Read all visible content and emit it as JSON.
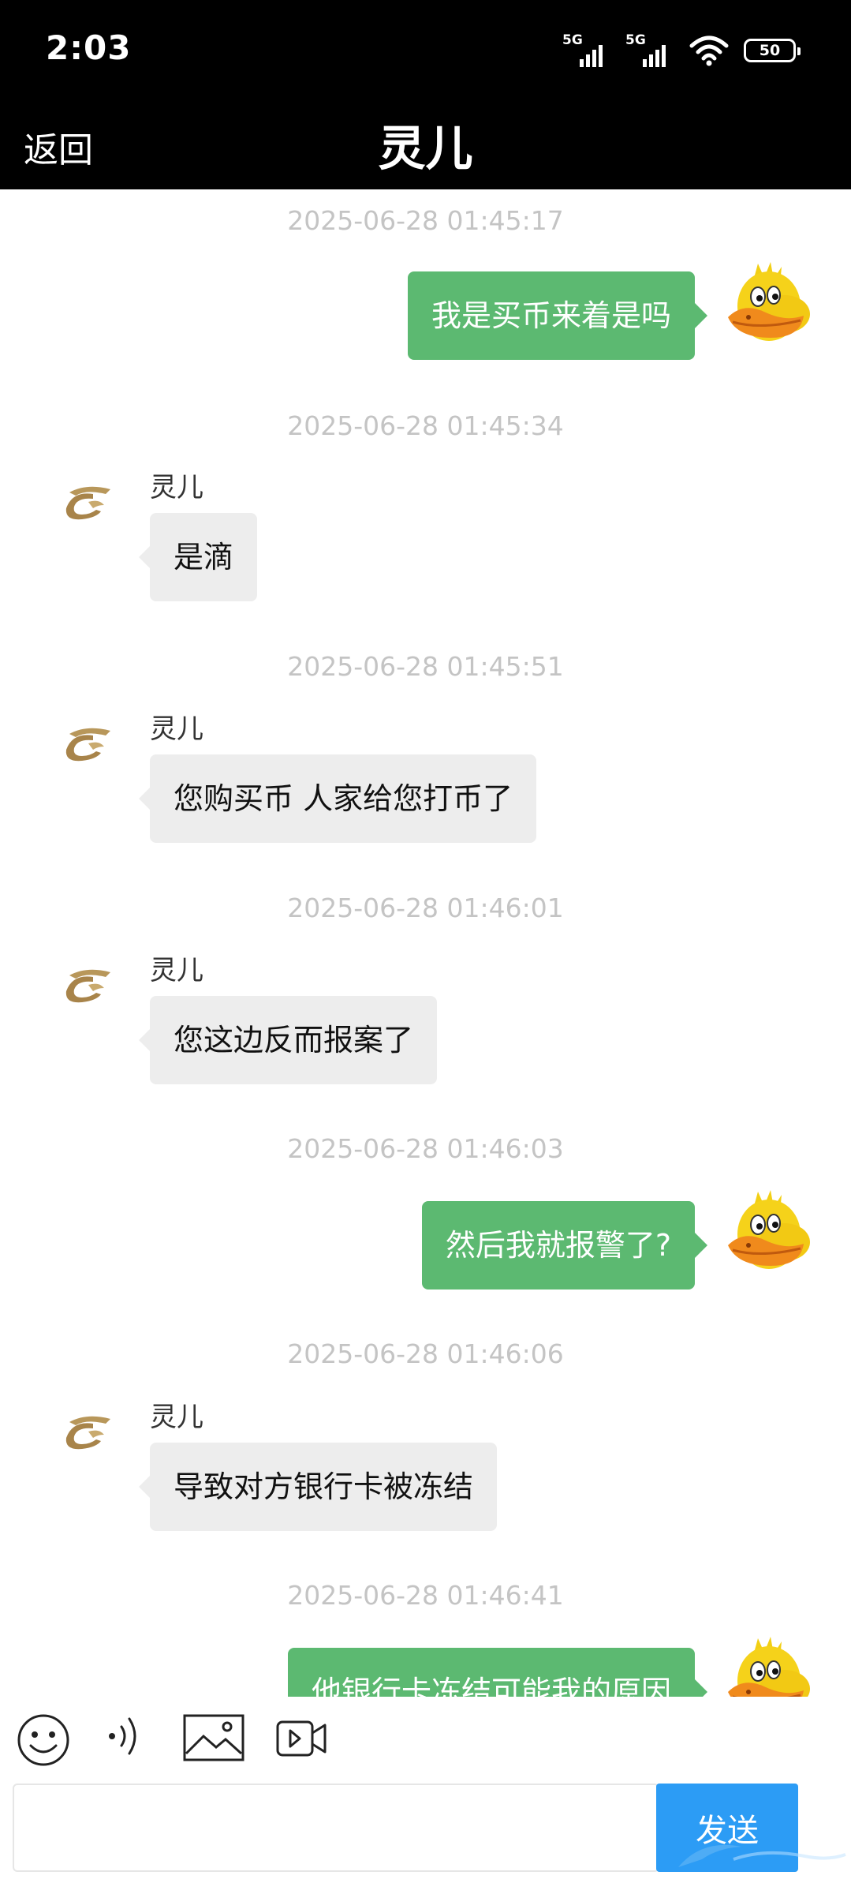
{
  "status_bar": {
    "time": "2:03",
    "signal_1_label": "5G",
    "signal_2_label": "5G",
    "battery": "50",
    "icons": [
      "signal-5g-icon",
      "signal-5g-icon",
      "wifi-icon",
      "battery-icon"
    ]
  },
  "nav": {
    "back_label": "返回",
    "title": "灵儿"
  },
  "messages": [
    {
      "timestamp": "2025-06-28 01:45:17",
      "direction": "out",
      "text": "我是买币来着是吗"
    },
    {
      "timestamp": "2025-06-28 01:45:34",
      "direction": "in",
      "sender": "灵儿",
      "text": "是滴"
    },
    {
      "timestamp": "2025-06-28 01:45:51",
      "direction": "in",
      "sender": "灵儿",
      "text": "您购买币 人家给您打币了"
    },
    {
      "timestamp": "2025-06-28 01:46:01",
      "direction": "in",
      "sender": "灵儿",
      "text": "您这边反而报案了"
    },
    {
      "timestamp": "2025-06-28 01:46:03",
      "direction": "out",
      "text": "然后我就报警了?"
    },
    {
      "timestamp": "2025-06-28 01:46:06",
      "direction": "in",
      "sender": "灵儿",
      "text": "导致对方银行卡被冻结"
    },
    {
      "timestamp": "2025-06-28 01:46:41",
      "direction": "out",
      "text": "他银行卡冻结可能我的原因"
    }
  ],
  "toolbar": {
    "icons": [
      "emoji-icon",
      "voice-icon",
      "image-icon",
      "video-icon"
    ]
  },
  "composer": {
    "input_value": "",
    "send_label": "发送"
  },
  "colors": {
    "outgoing_bubble": "#5cb971",
    "incoming_bubble": "#ededed",
    "send_button": "#2c9cf5",
    "header": "#000000",
    "timestamp": "#c4c4c4"
  }
}
